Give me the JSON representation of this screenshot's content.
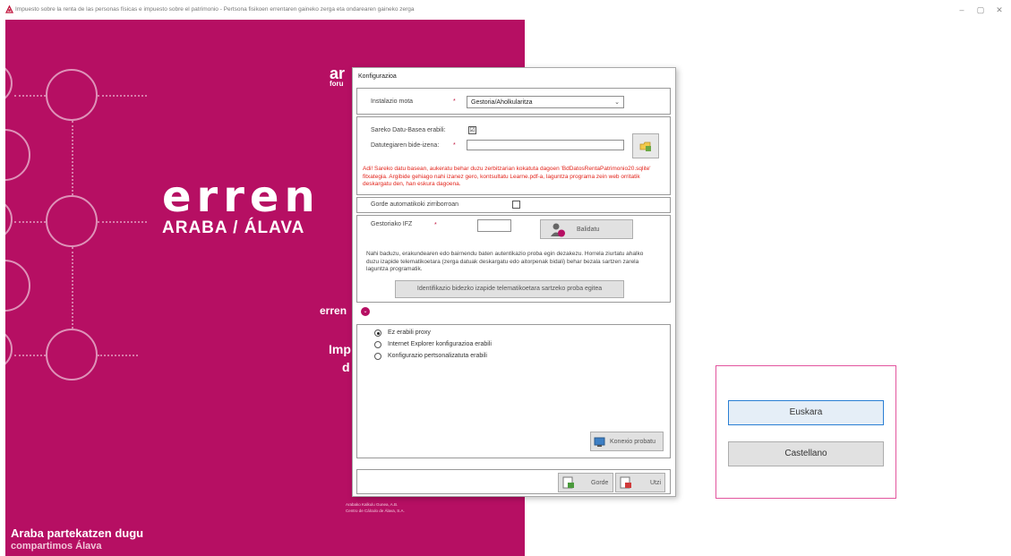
{
  "window": {
    "title": "Impuesto sobre la renta de las personas físicas e impuesto sobre el patrimonio - Pertsona fisikoen errentaren gaineko zerga eta ondarearen gaineko zerga",
    "minimize": "–",
    "maximize": "▢",
    "close": "✕"
  },
  "splash": {
    "logo_top": "ar",
    "logo_top_sub": "foru",
    "logo_main": "erren",
    "logo_region": "ARABA / ÁLAVA",
    "frag_erren": "erren",
    "frag_imp": "Imp",
    "frag_d": "d",
    "tagline_eu": "Araba partekatzen dugu",
    "tagline_es": "compartimos Álava",
    "credits_1": "Arabako Kalkulu Gunea, A.B.",
    "credits_2": "Centro de Cálculo de Álava, S.A."
  },
  "dialog": {
    "title": "Konfigurazioa",
    "install_type_label": "Instalazio mota",
    "install_type_value": "Gestoria/Aholkularitza",
    "shared_db_label": "Sareko Datu-Basea erabili:",
    "shared_db_checked": "☑",
    "db_path_label": "Datutegiaren bide-izena:",
    "warning": "Adi! Sareko datu basean, aukeratu behar duzu zerbitzarian kokatuta dagoen 'BdDatosRentaPatrimonio20.sqlite' fitxategia. Argibide gehiago nahi izanez gero, kontsultatu Learne.pdf-a, laguntza programa zein web orritatik deskargatu den, han eskura dagoena.",
    "autosave_label": "Gorde automatikoki zirriborroan",
    "gestoria_ifz_label": "Gestoriako IFZ",
    "validate_button": "Balidatu",
    "auth_paragraph": "Nahi baduzu, erakundearen edo bairnendu baten autentikazio proba egin dezakezu. Horrela ziurtatu ahalko duzu izapide telematikoetara (zerga datuak deskargatu edo aitorpenak bidali) behar bezala sartzen zarela laguntza programatik.",
    "test_access_button": "Identifikazio bidezko izapide telematikoetara sartzeko proba egitea",
    "proxy_options": [
      {
        "label": "Ez erabili proxy",
        "selected": true
      },
      {
        "label": "Internet Explorer konfigurazioa erabili",
        "selected": false
      },
      {
        "label": "Konfigurazio pertsonalizatuta erabili",
        "selected": false
      }
    ],
    "test_connection_button": "Konexio probatu",
    "save_button": "Gorde",
    "cancel_button": "Utzi",
    "required_mark": "*"
  },
  "language_panel": {
    "euskara": "Euskara",
    "castellano": "Castellano"
  },
  "colors": {
    "brand": "#b60f63",
    "warning_text": "#e2231a",
    "panel_border": "#e2559e"
  }
}
